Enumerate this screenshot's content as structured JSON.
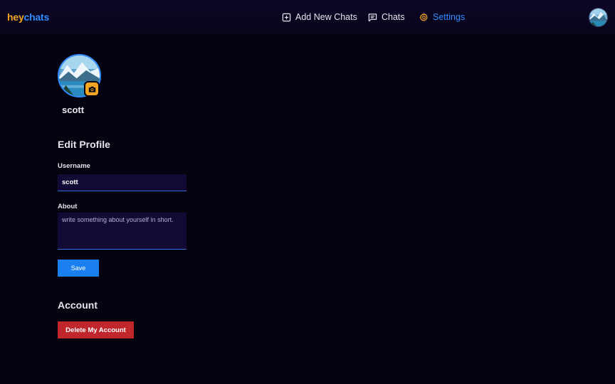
{
  "brand": {
    "part1": "hey",
    "part2": "chats",
    "colors": {
      "hey": "#f5a524",
      "chats": "#2f8cff"
    }
  },
  "nav": {
    "items": [
      {
        "label": "Add New Chats",
        "icon": "plus-square-icon",
        "active": false
      },
      {
        "label": "Chats",
        "icon": "message-square-icon",
        "active": false
      },
      {
        "label": "Settings",
        "icon": "gear-icon",
        "active": true
      }
    ],
    "active_color": "#2f8cff"
  },
  "user_avatar": {
    "icon": "landscape-avatar-icon"
  },
  "profile": {
    "username": "scott",
    "avatar_icon": "landscape-avatar-icon",
    "camera_icon": "camera-icon",
    "accent": "#2f8cff",
    "badge_color": "#f5a524"
  },
  "edit_profile": {
    "title": "Edit Profile",
    "username_label": "Username",
    "username_value": "scott",
    "about_label": "About",
    "about_placeholder": "write something about yourself in short.",
    "about_value": "",
    "save_label": "Save"
  },
  "account": {
    "title": "Account",
    "delete_label": "Delete My Account",
    "delete_color": "#c0272d"
  }
}
